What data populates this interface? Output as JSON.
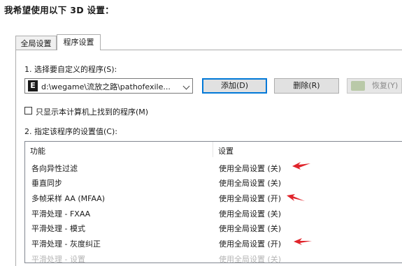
{
  "heading": "我希望使用以下 3D 设置：",
  "tabs": [
    {
      "label": "全局设置",
      "active": false
    },
    {
      "label": "程序设置",
      "active": true
    }
  ],
  "program_select": {
    "label": "1. 选择要自定义的程序(S):",
    "selected_value": "d:\\wegame\\流放之路\\pathofexile...",
    "icon": "program-e-icon"
  },
  "buttons": {
    "add": "添加(D)",
    "delete": "删除(R)",
    "restore": "恢复(Y)"
  },
  "checkbox": {
    "label": "只显示本计算机上找到的程序(M)",
    "checked": false
  },
  "settings_label": "2. 指定该程序的设置值(C):",
  "table": {
    "columns": [
      "功能",
      "设置"
    ],
    "rows": [
      {
        "feature": "各向异性过滤",
        "setting": "使用全局设置 (关)",
        "highlight": true
      },
      {
        "feature": "垂直同步",
        "setting": "使用全局设置 (关)",
        "highlight": false
      },
      {
        "feature": "多帧采样 AA (MFAA)",
        "setting": "使用全局设置 (开)",
        "highlight": true
      },
      {
        "feature": "平滑处理 - FXAA",
        "setting": "使用全局设置 (关)",
        "highlight": false
      },
      {
        "feature": "平滑处理 - 模式",
        "setting": "使用全局设置 (关)",
        "highlight": false
      },
      {
        "feature": "平滑处理 - 灰度纠正",
        "setting": "使用全局设置 (开)",
        "highlight": true
      },
      {
        "feature": "平滑处理 - 设置",
        "setting": "使用全局设置 (关)",
        "highlight": false
      }
    ]
  },
  "colors": {
    "annotation_arrow": "#e0242b",
    "focus_border": "#0078d7"
  }
}
